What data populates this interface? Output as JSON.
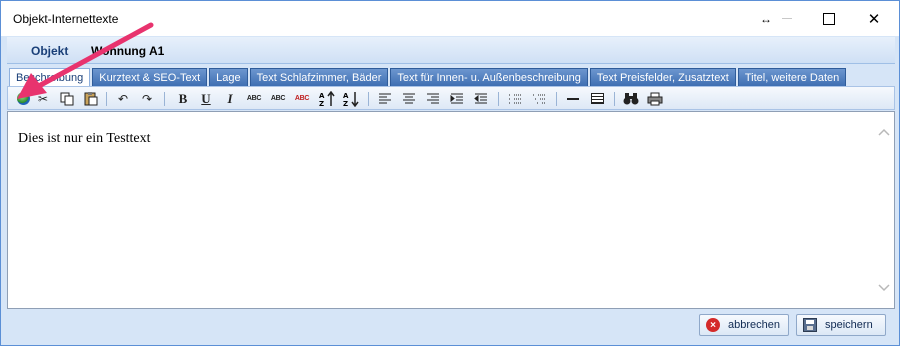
{
  "window": {
    "title": "Objekt-Internettexte",
    "controls": {
      "resize": "↔",
      "close": "✕"
    }
  },
  "header": {
    "label": "Objekt",
    "value": "Wohnung A1"
  },
  "tabs": [
    {
      "label": "Beschreibung",
      "active": true
    },
    {
      "label": "Kurztext & SEO-Text",
      "active": false
    },
    {
      "label": "Lage",
      "active": false
    },
    {
      "label": "Text Schlafzimmer, Bäder",
      "active": false
    },
    {
      "label": "Text für Innen- u. Außenbeschreibung",
      "active": false
    },
    {
      "label": "Text Preisfelder, Zusatztext",
      "active": false
    },
    {
      "label": "Titel, weitere Daten",
      "active": false
    }
  ],
  "toolbar": {
    "bold": "B",
    "underline": "U",
    "italic": "I",
    "strike": "ABC",
    "smallcaps": "ABC",
    "color": "ABC",
    "sort_asc": "↑",
    "sort_desc": "↓",
    "undo": "↶",
    "redo": "↷",
    "cut": "✂",
    "binoculars": "⚲",
    "icons": [
      "globe-icon",
      "cut-icon",
      "copy-icon",
      "paste-icon",
      "undo-icon",
      "redo-icon",
      "bold-icon",
      "underline-icon",
      "italic-icon",
      "strikethrough-icon",
      "small-caps-icon",
      "text-color-icon",
      "sort-ascending-icon",
      "sort-descending-icon",
      "align-left-icon",
      "align-center-icon",
      "align-right-icon",
      "indent-icon",
      "outdent-icon",
      "bullet-list-icon",
      "numbered-list-icon",
      "horizontal-rule-icon",
      "table-icon",
      "find-icon",
      "print-icon"
    ]
  },
  "editor": {
    "content": "Dies ist nur ein Testtext"
  },
  "footer": {
    "cancel_label": "abbrechen",
    "save_label": "speichern"
  },
  "colors": {
    "accent": "#3f6fb2",
    "annotation_arrow": "#e8336e",
    "panel_bg": "#d6e5f7"
  }
}
